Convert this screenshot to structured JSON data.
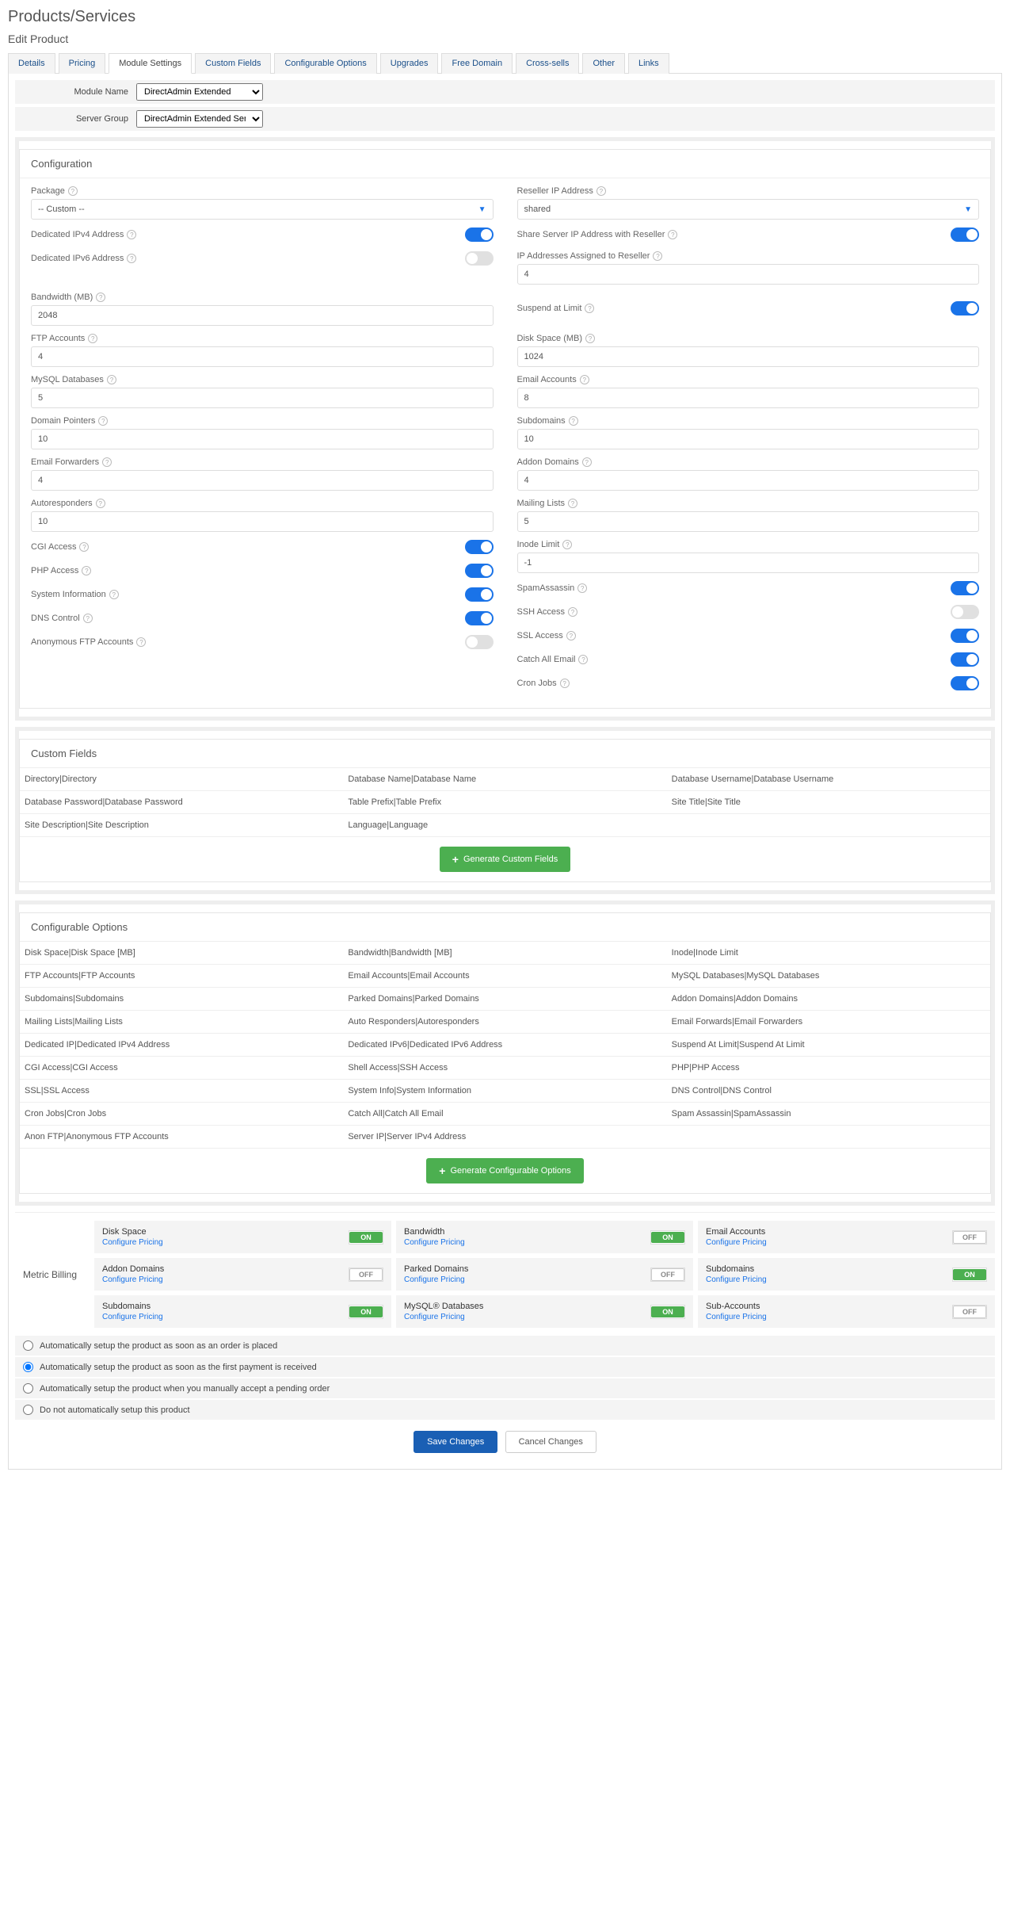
{
  "page": {
    "title": "Products/Services",
    "subtitle": "Edit Product"
  },
  "tabs": [
    "Details",
    "Pricing",
    "Module Settings",
    "Custom Fields",
    "Configurable Options",
    "Upgrades",
    "Free Domain",
    "Cross-sells",
    "Other",
    "Links"
  ],
  "active_tab": "Module Settings",
  "module": {
    "name_label": "Module Name",
    "name_value": "DirectAdmin Extended",
    "server_label": "Server Group",
    "server_value": "DirectAdmin Extended Server"
  },
  "configuration": {
    "header": "Configuration",
    "package_label": "Package",
    "package_value": "-- Custom --",
    "reseller_ip_label": "Reseller IP Address",
    "reseller_ip_value": "shared",
    "left_toggles": [
      {
        "label": "Dedicated IPv4 Address",
        "on": true
      },
      {
        "label": "Dedicated IPv6 Address",
        "on": false
      }
    ],
    "right_toggles_top": [
      {
        "label": "Share Server IP Address with Reseller",
        "on": true
      }
    ],
    "ip_assigned_label": "IP Addresses Assigned to Reseller",
    "ip_assigned_value": "4",
    "bandwidth_label": "Bandwidth (MB)",
    "bandwidth_value": "2048",
    "suspend_label": "Suspend at Limit",
    "suspend_on": true,
    "left_inputs": [
      {
        "label": "FTP Accounts",
        "value": "4"
      },
      {
        "label": "MySQL Databases",
        "value": "5"
      },
      {
        "label": "Domain Pointers",
        "value": "10"
      },
      {
        "label": "Email Forwarders",
        "value": "4"
      },
      {
        "label": "Autoresponders",
        "value": "10"
      }
    ],
    "right_inputs": [
      {
        "label": "Disk Space (MB)",
        "value": "1024"
      },
      {
        "label": "Email Accounts",
        "value": "8"
      },
      {
        "label": "Subdomains",
        "value": "10"
      },
      {
        "label": "Addon Domains",
        "value": "4"
      },
      {
        "label": "Mailing Lists",
        "value": "5"
      }
    ],
    "left_toggles2": [
      {
        "label": "CGI Access",
        "on": true
      },
      {
        "label": "PHP Access",
        "on": true
      },
      {
        "label": "System Information",
        "on": true
      },
      {
        "label": "DNS Control",
        "on": true
      },
      {
        "label": "Anonymous FTP Accounts",
        "on": false
      }
    ],
    "inode_label": "Inode Limit",
    "inode_value": "-1",
    "right_toggles2": [
      {
        "label": "SpamAssassin",
        "on": true
      },
      {
        "label": "SSH Access",
        "on": false
      },
      {
        "label": "SSL Access",
        "on": true
      },
      {
        "label": "Catch All Email",
        "on": true
      },
      {
        "label": "Cron Jobs",
        "on": true
      }
    ]
  },
  "custom_fields": {
    "header": "Custom Fields",
    "rows": [
      [
        "Directory|Directory",
        "Database Name|Database Name",
        "Database Username|Database Username"
      ],
      [
        "Database Password|Database Password",
        "Table Prefix|Table Prefix",
        "Site Title|Site Title"
      ],
      [
        "Site Description|Site Description",
        "Language|Language",
        ""
      ]
    ],
    "button": "Generate Custom Fields"
  },
  "config_options": {
    "header": "Configurable Options",
    "rows": [
      [
        "Disk Space|Disk Space [MB]",
        "Bandwidth|Bandwidth [MB]",
        "Inode|Inode Limit"
      ],
      [
        "FTP Accounts|FTP Accounts",
        "Email Accounts|Email Accounts",
        "MySQL Databases|MySQL Databases"
      ],
      [
        "Subdomains|Subdomains",
        "Parked Domains|Parked Domains",
        "Addon Domains|Addon Domains"
      ],
      [
        "Mailing Lists|Mailing Lists",
        "Auto Responders|Autoresponders",
        "Email Forwards|Email Forwarders"
      ],
      [
        "Dedicated IP|Dedicated IPv4 Address",
        "Dedicated IPv6|Dedicated IPv6 Address",
        "Suspend At Limit|Suspend At Limit"
      ],
      [
        "CGI Access|CGI Access",
        "Shell Access|SSH Access",
        "PHP|PHP Access"
      ],
      [
        "SSL|SSL Access",
        "System Info|System Information",
        "DNS Control|DNS Control"
      ],
      [
        "Cron Jobs|Cron Jobs",
        "Catch All|Catch All Email",
        "Spam Assassin|SpamAssassin"
      ],
      [
        "Anon FTP|Anonymous FTP Accounts",
        "Server IP|Server IPv4 Address",
        ""
      ]
    ],
    "button": "Generate Configurable Options"
  },
  "metric": {
    "label": "Metric Billing",
    "link_text": "Configure Pricing",
    "cards": [
      {
        "name": "Disk Space",
        "on": true
      },
      {
        "name": "Bandwidth",
        "on": true
      },
      {
        "name": "Email Accounts",
        "on": false
      },
      {
        "name": "Addon Domains",
        "on": false
      },
      {
        "name": "Parked Domains",
        "on": false
      },
      {
        "name": "Subdomains",
        "on": true
      },
      {
        "name": "Subdomains",
        "on": true
      },
      {
        "name": "MySQL® Databases",
        "on": true
      },
      {
        "name": "Sub-Accounts",
        "on": false
      }
    ]
  },
  "setup_options": [
    "Automatically setup the product as soon as an order is placed",
    "Automatically setup the product as soon as the first payment is received",
    "Automatically setup the product when you manually accept a pending order",
    "Do not automatically setup this product"
  ],
  "setup_selected": 1,
  "footer": {
    "save": "Save Changes",
    "cancel": "Cancel Changes"
  },
  "badges": {
    "on": "ON",
    "off": "OFF"
  }
}
